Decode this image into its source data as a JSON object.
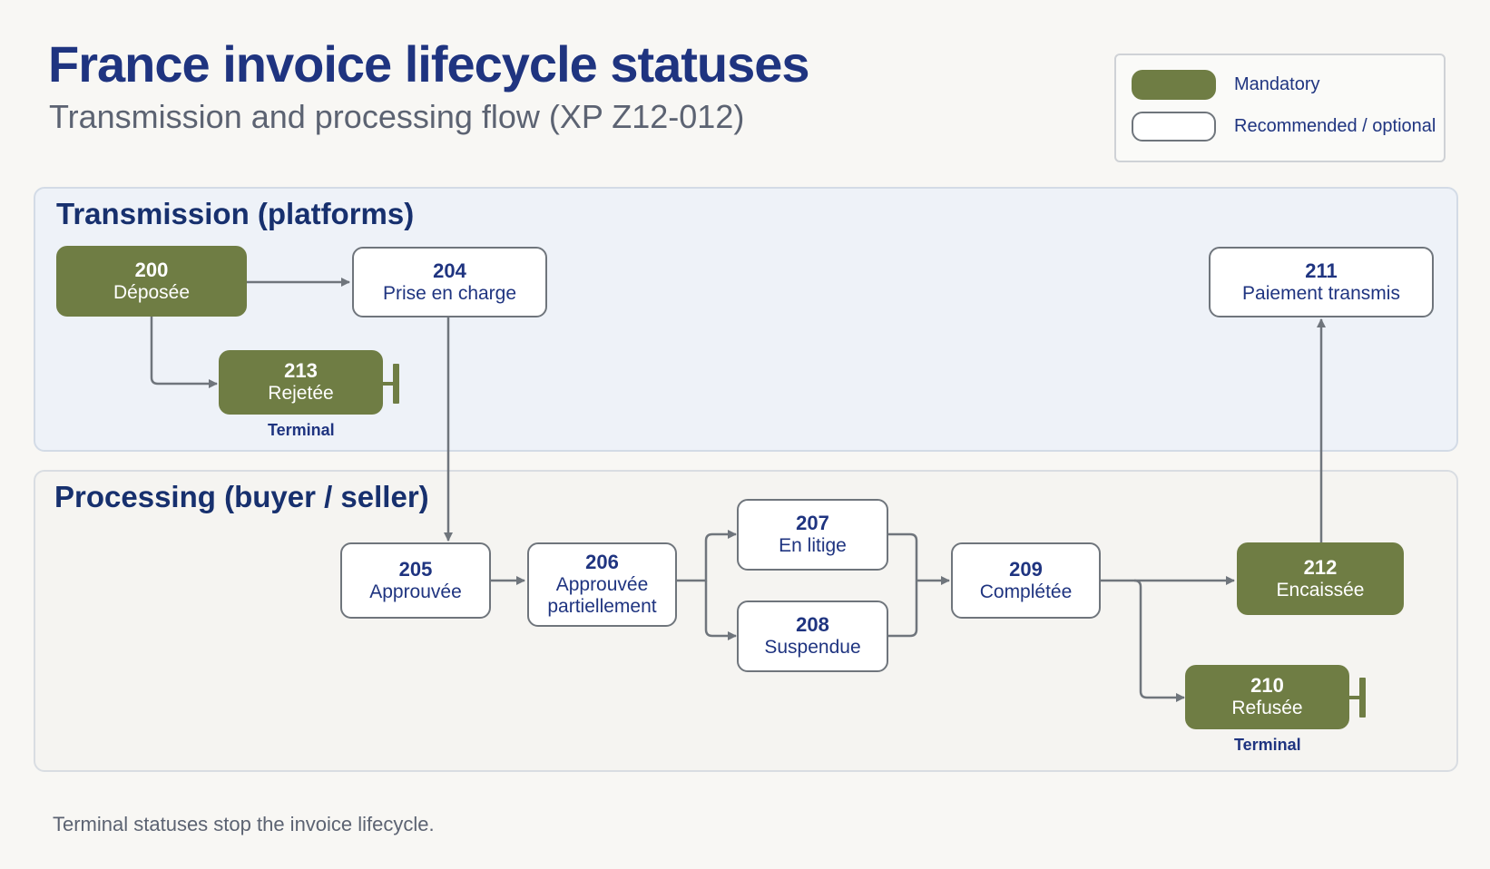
{
  "header": {
    "title": "France invoice lifecycle statuses",
    "subtitle": "Transmission and processing flow (XP Z12-012)"
  },
  "legend": {
    "mandatory_label": "Mandatory",
    "optional_label": "Recommended / optional"
  },
  "sections": {
    "transmission": "Transmission (platforms)",
    "processing": "Processing (buyer / seller)"
  },
  "statuses": {
    "s200": {
      "code": "200",
      "label": "Déposée",
      "type": "mandatory"
    },
    "s204": {
      "code": "204",
      "label": "Prise en charge",
      "type": "optional"
    },
    "s211": {
      "code": "211",
      "label": "Paiement transmis",
      "type": "optional"
    },
    "s213": {
      "code": "213",
      "label": "Rejetée",
      "type": "mandatory",
      "terminal": "Terminal"
    },
    "s205": {
      "code": "205",
      "label": "Approuvée",
      "type": "optional"
    },
    "s206": {
      "code": "206",
      "label": "Approuvée partiellement",
      "type": "optional"
    },
    "s207": {
      "code": "207",
      "label": "En litige",
      "type": "optional"
    },
    "s208": {
      "code": "208",
      "label": "Suspendue",
      "type": "optional"
    },
    "s209": {
      "code": "209",
      "label": "Complétée",
      "type": "optional"
    },
    "s212": {
      "code": "212",
      "label": "Encaissée",
      "type": "mandatory"
    },
    "s210": {
      "code": "210",
      "label": "Refusée",
      "type": "mandatory",
      "terminal": "Terminal"
    }
  },
  "footnote": "Terminal statuses stop the invoice lifecycle.",
  "colors": {
    "mandatory": "#6f7d44",
    "optional_border": "#6f757c",
    "title": "#1f3480",
    "connector": "#6f757c"
  }
}
